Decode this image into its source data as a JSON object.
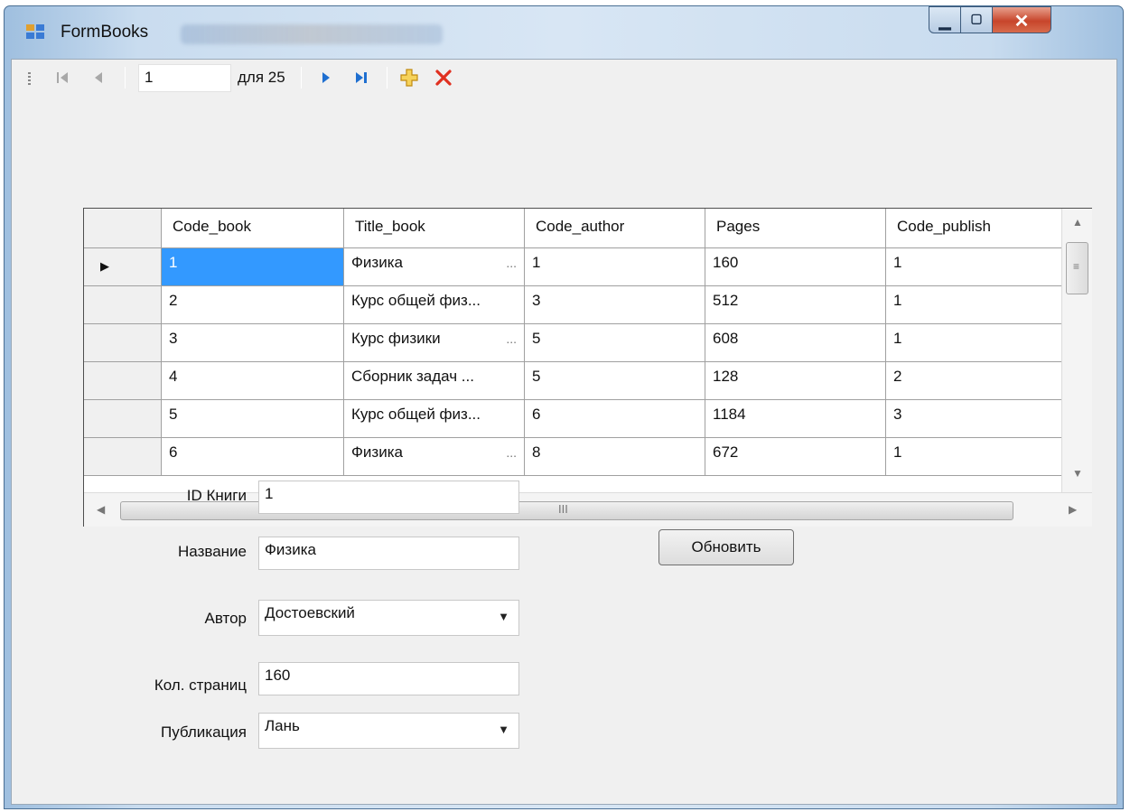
{
  "window": {
    "title": "FormBooks",
    "controls": {
      "minimize_icon": "minimize-icon",
      "maximize_icon": "maximize-icon",
      "close_icon": "close-icon"
    }
  },
  "navigator": {
    "position": "1",
    "count_text": "для 25",
    "icons": [
      "move-first-icon",
      "move-previous-icon",
      "move-next-icon",
      "move-last-icon",
      "add-new-icon",
      "delete-icon"
    ]
  },
  "grid": {
    "columns": [
      "Code_book",
      "Title_book",
      "Code_author",
      "Pages",
      "Code_publish"
    ],
    "rows": [
      [
        "1",
        "Физика",
        "1",
        "160",
        "1"
      ],
      [
        "2",
        "Курс общей физ...",
        "3",
        "512",
        "1"
      ],
      [
        "3",
        "Курс физики",
        "5",
        "608",
        "1"
      ],
      [
        "4",
        "Сборник задач ...",
        "5",
        "128",
        "2"
      ],
      [
        "5",
        "Курс общей физ...",
        "6",
        "1184",
        "3"
      ],
      [
        "6",
        "Физика",
        "8",
        "672",
        "1"
      ]
    ],
    "row_ellipsis": [
      "...",
      "",
      "...",
      "",
      "",
      "..."
    ],
    "scroll_grip": "III",
    "selected_row": 0,
    "selection_color": "#3399ff"
  },
  "form": {
    "id_label": "ID Книги",
    "id_value": "1",
    "title_label": "Название",
    "title_value": "Физика",
    "author_label": "Автор",
    "author_value": "Достоевский",
    "pages_label": "Кол. страниц",
    "pages_value": "160",
    "publisher_label": "Публикация",
    "publisher_value": "Лань",
    "update_button": "Обновить"
  }
}
